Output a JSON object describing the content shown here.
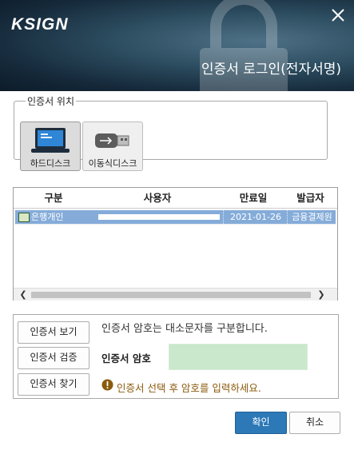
{
  "header": {
    "logo": "KSIGN",
    "title": "인증서 로그인(전자서명)"
  },
  "location": {
    "legend": "인증서 위치",
    "drives": [
      {
        "label": "하드디스크",
        "icon": "laptop-icon",
        "selected": true
      },
      {
        "label": "이동식디스크",
        "icon": "usb-icon",
        "selected": false
      }
    ]
  },
  "cert_table": {
    "columns": [
      "구분",
      "사용자",
      "만료일",
      "발급자"
    ],
    "rows": [
      {
        "type": "은행개인",
        "user": "",
        "expiry": "2021-01-26",
        "issuer": "금융결제원"
      }
    ]
  },
  "password_panel": {
    "buttons": [
      "인증서 보기",
      "인증서 검증",
      "인증서 찾기"
    ],
    "case_note": "인증서 암호는 대소문자를 구분합니다.",
    "password_label": "인증서 암호",
    "password_value": "",
    "hint": "인증서 선택 후 암호를 입력하세요."
  },
  "footer": {
    "ok": "확인",
    "cancel": "취소"
  },
  "colors": {
    "accent": "#2d79b8",
    "selected_row": "#85acd9",
    "password_field": "#c9e8cc",
    "hint_text": "#8a5a0c"
  }
}
